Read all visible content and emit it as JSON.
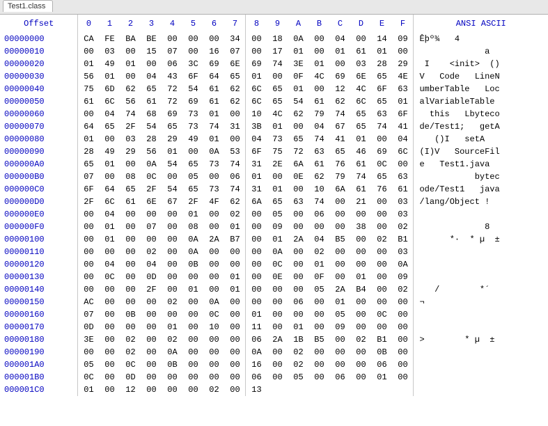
{
  "tab": {
    "label": "Test1.class"
  },
  "headers": {
    "offset": "Offset",
    "ansi": "ANSI ASCII",
    "hexCols": [
      "0",
      "1",
      "2",
      "3",
      "4",
      "5",
      "6",
      "7",
      "8",
      "9",
      "A",
      "B",
      "C",
      "D",
      "E",
      "F"
    ]
  },
  "rows": [
    {
      "offset": "00000000",
      "hex": [
        "CA",
        "FE",
        "BA",
        "BE",
        "00",
        "00",
        "00",
        "34",
        "00",
        "18",
        "0A",
        "00",
        "04",
        "00",
        "14",
        "09"
      ],
      "ansi": "Êþº¾   4        "
    },
    {
      "offset": "00000010",
      "hex": [
        "00",
        "03",
        "00",
        "15",
        "07",
        "00",
        "16",
        "07",
        "00",
        "17",
        "01",
        "00",
        "01",
        "61",
        "01",
        "00"
      ],
      "ansi": "             a  "
    },
    {
      "offset": "00000020",
      "hex": [
        "01",
        "49",
        "01",
        "00",
        "06",
        "3C",
        "69",
        "6E",
        "69",
        "74",
        "3E",
        "01",
        "00",
        "03",
        "28",
        "29"
      ],
      "ansi": " I    <init>  ()"
    },
    {
      "offset": "00000030",
      "hex": [
        "56",
        "01",
        "00",
        "04",
        "43",
        "6F",
        "64",
        "65",
        "01",
        "00",
        "0F",
        "4C",
        "69",
        "6E",
        "65",
        "4E"
      ],
      "ansi": "V   Code   LineN"
    },
    {
      "offset": "00000040",
      "hex": [
        "75",
        "6D",
        "62",
        "65",
        "72",
        "54",
        "61",
        "62",
        "6C",
        "65",
        "01",
        "00",
        "12",
        "4C",
        "6F",
        "63"
      ],
      "ansi": "umberTable   Loc"
    },
    {
      "offset": "00000050",
      "hex": [
        "61",
        "6C",
        "56",
        "61",
        "72",
        "69",
        "61",
        "62",
        "6C",
        "65",
        "54",
        "61",
        "62",
        "6C",
        "65",
        "01"
      ],
      "ansi": "alVariableTable "
    },
    {
      "offset": "00000060",
      "hex": [
        "00",
        "04",
        "74",
        "68",
        "69",
        "73",
        "01",
        "00",
        "10",
        "4C",
        "62",
        "79",
        "74",
        "65",
        "63",
        "6F"
      ],
      "ansi": "  this   Lbyteco"
    },
    {
      "offset": "00000070",
      "hex": [
        "64",
        "65",
        "2F",
        "54",
        "65",
        "73",
        "74",
        "31",
        "3B",
        "01",
        "00",
        "04",
        "67",
        "65",
        "74",
        "41"
      ],
      "ansi": "de/Test1;   getA"
    },
    {
      "offset": "00000080",
      "hex": [
        "01",
        "00",
        "03",
        "28",
        "29",
        "49",
        "01",
        "00",
        "04",
        "73",
        "65",
        "74",
        "41",
        "01",
        "00",
        "04"
      ],
      "ansi": "   ()I   setA   "
    },
    {
      "offset": "00000090",
      "hex": [
        "28",
        "49",
        "29",
        "56",
        "01",
        "00",
        "0A",
        "53",
        "6F",
        "75",
        "72",
        "63",
        "65",
        "46",
        "69",
        "6C"
      ],
      "ansi": "(I)V   SourceFil"
    },
    {
      "offset": "000000A0",
      "hex": [
        "65",
        "01",
        "00",
        "0A",
        "54",
        "65",
        "73",
        "74",
        "31",
        "2E",
        "6A",
        "61",
        "76",
        "61",
        "0C",
        "00"
      ],
      "ansi": "e   Test1.java  "
    },
    {
      "offset": "000000B0",
      "hex": [
        "07",
        "00",
        "08",
        "0C",
        "00",
        "05",
        "00",
        "06",
        "01",
        "00",
        "0E",
        "62",
        "79",
        "74",
        "65",
        "63"
      ],
      "ansi": "           bytec"
    },
    {
      "offset": "000000C0",
      "hex": [
        "6F",
        "64",
        "65",
        "2F",
        "54",
        "65",
        "73",
        "74",
        "31",
        "01",
        "00",
        "10",
        "6A",
        "61",
        "76",
        "61"
      ],
      "ansi": "ode/Test1   java"
    },
    {
      "offset": "000000D0",
      "hex": [
        "2F",
        "6C",
        "61",
        "6E",
        "67",
        "2F",
        "4F",
        "62",
        "6A",
        "65",
        "63",
        "74",
        "00",
        "21",
        "00",
        "03"
      ],
      "ansi": "/lang/Object !  "
    },
    {
      "offset": "000000E0",
      "hex": [
        "00",
        "04",
        "00",
        "00",
        "00",
        "01",
        "00",
        "02",
        "00",
        "05",
        "00",
        "06",
        "00",
        "00",
        "00",
        "03"
      ],
      "ansi": "                "
    },
    {
      "offset": "000000F0",
      "hex": [
        "00",
        "01",
        "00",
        "07",
        "00",
        "08",
        "00",
        "01",
        "00",
        "09",
        "00",
        "00",
        "00",
        "38",
        "00",
        "02"
      ],
      "ansi": "             8  "
    },
    {
      "offset": "00000100",
      "hex": [
        "00",
        "01",
        "00",
        "00",
        "00",
        "0A",
        "2A",
        "B7",
        "00",
        "01",
        "2A",
        "04",
        "B5",
        "00",
        "02",
        "B1"
      ],
      "ansi": "      *·  * µ  ±"
    },
    {
      "offset": "00000110",
      "hex": [
        "00",
        "00",
        "00",
        "02",
        "00",
        "0A",
        "00",
        "00",
        "00",
        "0A",
        "00",
        "02",
        "00",
        "00",
        "00",
        "03"
      ],
      "ansi": "                "
    },
    {
      "offset": "00000120",
      "hex": [
        "00",
        "04",
        "00",
        "04",
        "00",
        "0B",
        "00",
        "00",
        "00",
        "0C",
        "00",
        "01",
        "00",
        "00",
        "00",
        "0A"
      ],
      "ansi": "                "
    },
    {
      "offset": "00000130",
      "hex": [
        "00",
        "0C",
        "00",
        "0D",
        "00",
        "00",
        "00",
        "01",
        "00",
        "0E",
        "00",
        "0F",
        "00",
        "01",
        "00",
        "09"
      ],
      "ansi": "                "
    },
    {
      "offset": "00000140",
      "hex": [
        "00",
        "00",
        "00",
        "2F",
        "00",
        "01",
        "00",
        "01",
        "00",
        "00",
        "00",
        "05",
        "2A",
        "B4",
        "00",
        "02"
      ],
      "ansi": "   /        *´  "
    },
    {
      "offset": "00000150",
      "hex": [
        "AC",
        "00",
        "00",
        "00",
        "02",
        "00",
        "0A",
        "00",
        "00",
        "00",
        "06",
        "00",
        "01",
        "00",
        "00",
        "00"
      ],
      "ansi": "¬               "
    },
    {
      "offset": "00000160",
      "hex": [
        "07",
        "00",
        "0B",
        "00",
        "00",
        "00",
        "0C",
        "00",
        "01",
        "00",
        "00",
        "00",
        "05",
        "00",
        "0C",
        "00"
      ],
      "ansi": "                "
    },
    {
      "offset": "00000170",
      "hex": [
        "0D",
        "00",
        "00",
        "00",
        "01",
        "00",
        "10",
        "00",
        "11",
        "00",
        "01",
        "00",
        "09",
        "00",
        "00",
        "00"
      ],
      "ansi": "                "
    },
    {
      "offset": "00000180",
      "hex": [
        "3E",
        "00",
        "02",
        "00",
        "02",
        "00",
        "00",
        "00",
        "06",
        "2A",
        "1B",
        "B5",
        "00",
        "02",
        "B1",
        "00"
      ],
      "ansi": ">        * µ  ± "
    },
    {
      "offset": "00000190",
      "hex": [
        "00",
        "00",
        "02",
        "00",
        "0A",
        "00",
        "00",
        "00",
        "0A",
        "00",
        "02",
        "00",
        "00",
        "00",
        "0B",
        "00"
      ],
      "ansi": "                "
    },
    {
      "offset": "000001A0",
      "hex": [
        "05",
        "00",
        "0C",
        "00",
        "0B",
        "00",
        "00",
        "00",
        "16",
        "00",
        "02",
        "00",
        "00",
        "00",
        "06",
        "00"
      ],
      "ansi": "                "
    },
    {
      "offset": "000001B0",
      "hex": [
        "0C",
        "00",
        "0D",
        "00",
        "00",
        "00",
        "00",
        "00",
        "06",
        "00",
        "05",
        "00",
        "06",
        "00",
        "01",
        "00"
      ],
      "ansi": "                "
    },
    {
      "offset": "000001C0",
      "hex": [
        "01",
        "00",
        "12",
        "00",
        "00",
        "00",
        "02",
        "00",
        "13",
        "",
        "",
        "",
        "",
        "",
        "",
        ""
      ],
      "ansi": "         "
    }
  ]
}
